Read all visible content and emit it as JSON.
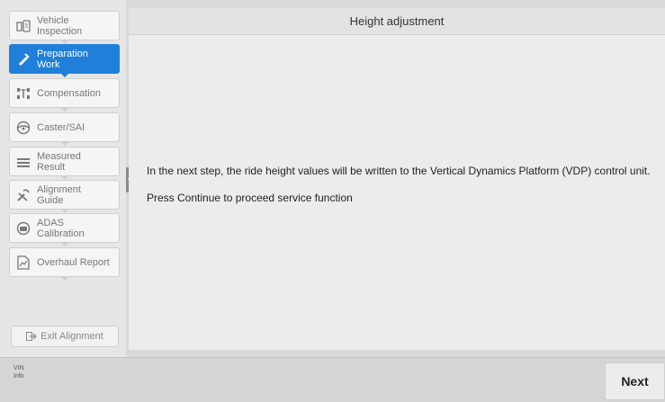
{
  "sidebar": {
    "items": [
      {
        "label": "Vehicle\nInspection",
        "icon": "vehicle-inspection-icon",
        "active": false
      },
      {
        "label": "Preparation\nWork",
        "icon": "preparation-work-icon",
        "active": true
      },
      {
        "label": "Compensation",
        "icon": "compensation-icon",
        "active": false
      },
      {
        "label": "Caster/SAI",
        "icon": "steering-wheel-icon",
        "active": false
      },
      {
        "label": "Measured\nResult",
        "icon": "measured-result-icon",
        "active": false
      },
      {
        "label": "Alignment\nGuide",
        "icon": "wrench-icon",
        "active": false
      },
      {
        "label": "ADAS\nCalibration",
        "icon": "adas-icon",
        "active": false
      },
      {
        "label": "Overhaul Report",
        "icon": "report-icon",
        "active": false
      }
    ],
    "exit_label": "Exit Alignment"
  },
  "main": {
    "title": "Height adjustment",
    "message_line1": "In the next step, the ride height values will be written to the Vertical Dynamics Platform (VDP) control unit.",
    "message_line2": "Press Continue to proceed service function"
  },
  "bottom": {
    "vin_label": "VIN",
    "info_label": "Info",
    "next_label": "Next"
  },
  "colors": {
    "active_nav": "#1f7fd9",
    "sidebar_bg": "#e6e6e6",
    "content_bg": "#ececec"
  }
}
